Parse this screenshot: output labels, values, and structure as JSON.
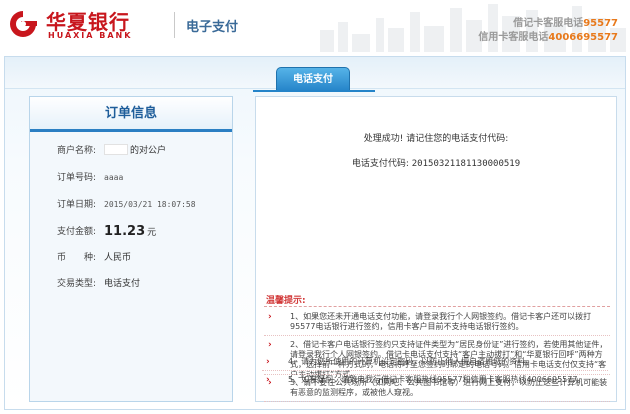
{
  "header": {
    "bank_name_cn": "华夏银行",
    "bank_name_en": "HUAXIA BANK",
    "product": "电子支付",
    "debit_label": "借记卡客服电话",
    "debit_number": "95577",
    "credit_label": "信用卡客服电话",
    "credit_number": "4006695577"
  },
  "tab": {
    "label": "电话支付"
  },
  "order": {
    "title": "订单信息",
    "fields": [
      {
        "label": "商户名称:",
        "value": "的对公户"
      },
      {
        "label": "订单号码:",
        "value": "aaaa"
      },
      {
        "label": "订单日期:",
        "value": "2015/03/21 18:07:58"
      },
      {
        "label": "支付金额:",
        "amount": "11.23",
        "unit": "元"
      },
      {
        "label": "币　　种:",
        "value": "人民币"
      },
      {
        "label": "交易类型:",
        "value": "电话支付"
      }
    ]
  },
  "result": {
    "success_msg": "处理成功! 请记住您的电话支付代码:",
    "code_label": "电话支付代码:",
    "code_value": "20150321181130000519"
  },
  "tips": {
    "title": "温馨提示:",
    "items": [
      "1、如果您还未开通电话支付功能，请登录我行个人网银签约。借记卡客户还可以拨打95577电话银行进行签约，信用卡客户目前不支持电话银行签约。",
      "2、借记卡客户电话银行签约只支持证件类型为“居民身份证”进行签约，若使用其他证件，请登录我行个人网银签约。借记卡电话支付支持“客户主动拔打”和“华夏银行回呼”两种方式，选择前一种方式的，电话将呼至您签约时绑定的电话号码。信用卡电话支付仅支持“客户主动拔打”方式。",
      "3、请不要在公共场所（如网吧、公共图书馆等）进行网上支付，以防止这些计算机可能装有恶意的监测程序，或被他人窥视。",
      "4、请为您所使用的计算机设定密码，以防止他人擅自盗用您的资料。",
      "5、如有疑问，请致电我行借记卡客服热线95577和信用卡客服热线4006695577。"
    ]
  }
}
